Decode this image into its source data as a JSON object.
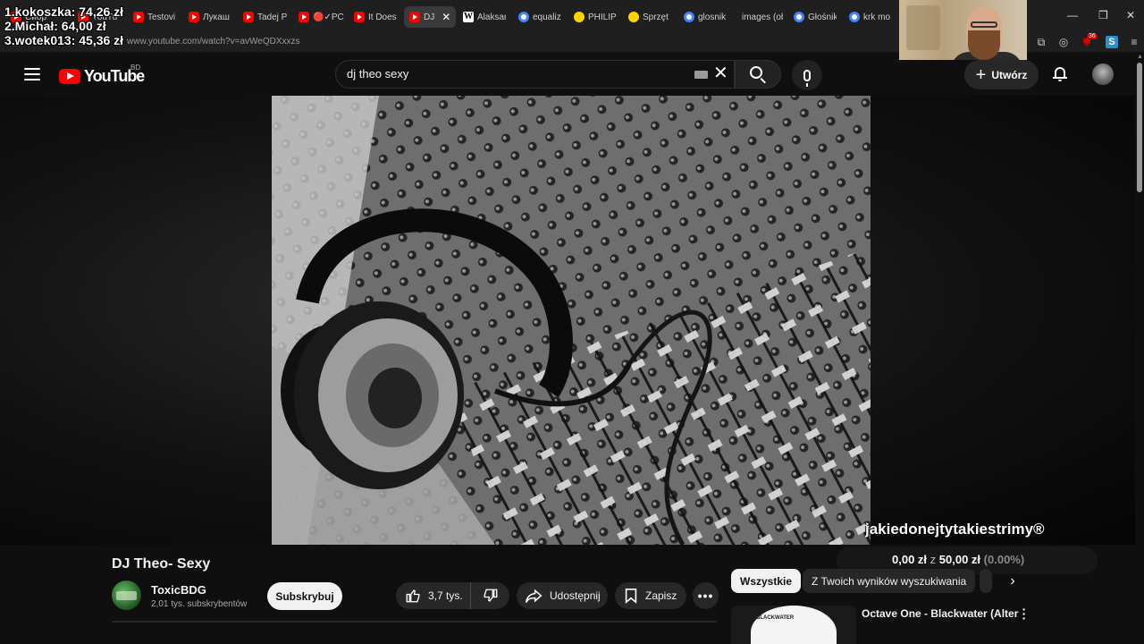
{
  "browser": {
    "tabs": [
      {
        "label": "Сибр",
        "icon": "youtube-favicon"
      },
      {
        "label": "YouTu",
        "icon": "youtube-favicon"
      },
      {
        "label": "Testovi",
        "icon": "youtube-favicon"
      },
      {
        "label": "Лукаш",
        "icon": "youtube-favicon"
      },
      {
        "label": "Tadej P",
        "icon": "youtube-favicon"
      },
      {
        "label": "🔴✓PC",
        "icon": "youtube-favicon"
      },
      {
        "label": "It Does",
        "icon": "youtube-favicon"
      },
      {
        "label": "DJ",
        "icon": "youtube-favicon",
        "active": true
      },
      {
        "label": "Alaksar",
        "icon": "wikipedia-favicon"
      },
      {
        "label": "equaliz",
        "icon": "google-favicon"
      },
      {
        "label": "PHILIPS",
        "icon": "philips-favicon"
      },
      {
        "label": "Sprzęt",
        "icon": "philips-favicon"
      },
      {
        "label": "glosnik",
        "icon": "google-favicon"
      },
      {
        "label": "images (ob",
        "icon": "image-favicon"
      },
      {
        "label": "Głośnik",
        "icon": "google-favicon"
      },
      {
        "label": "krk mo",
        "icon": "google-favicon"
      }
    ],
    "tab_close": "✕",
    "url": "www.youtube.com/watch?v=avWeQDXxxzs",
    "extension_badge": "36",
    "extension_s": "S"
  },
  "overlay": {
    "leaderboard": [
      "1.kokoszka: 74,26 zł",
      "2.Michał: 64,00 zł",
      "3.wotek013: 45,36 zł"
    ],
    "channel_watermark": "jakiedonejtytakiestrimy®",
    "goal": {
      "current": "0,00 zł",
      "sep": "z",
      "target": "50,00 zł",
      "percent": "(0.00%)"
    }
  },
  "masthead": {
    "logo_text": "YouTube",
    "country_code": "BD",
    "search_value": "dj theo sexy",
    "create_label": "Utwórz"
  },
  "video": {
    "title": "DJ Theo- Sexy",
    "channel_name": "ToxicBDG",
    "subscribers": "2,01 tys. subskrybentów",
    "subscribe_label": "Subskrybuj",
    "likes": "3,7 tys.",
    "share_label": "Udostępnij",
    "save_label": "Zapisz",
    "more_label": "•••"
  },
  "sidebar": {
    "chips": [
      "Wszystkie",
      "Z Twoich wyników wyszukiwania"
    ],
    "next_chevron": "›",
    "recommendation_title": "Octave One - Blackwater (Alter",
    "recommendation_thumb_label": "BLACKWATER"
  },
  "colors": {
    "accent": "#ff0000",
    "background": "#0f0f0f",
    "pill": "#272727"
  }
}
